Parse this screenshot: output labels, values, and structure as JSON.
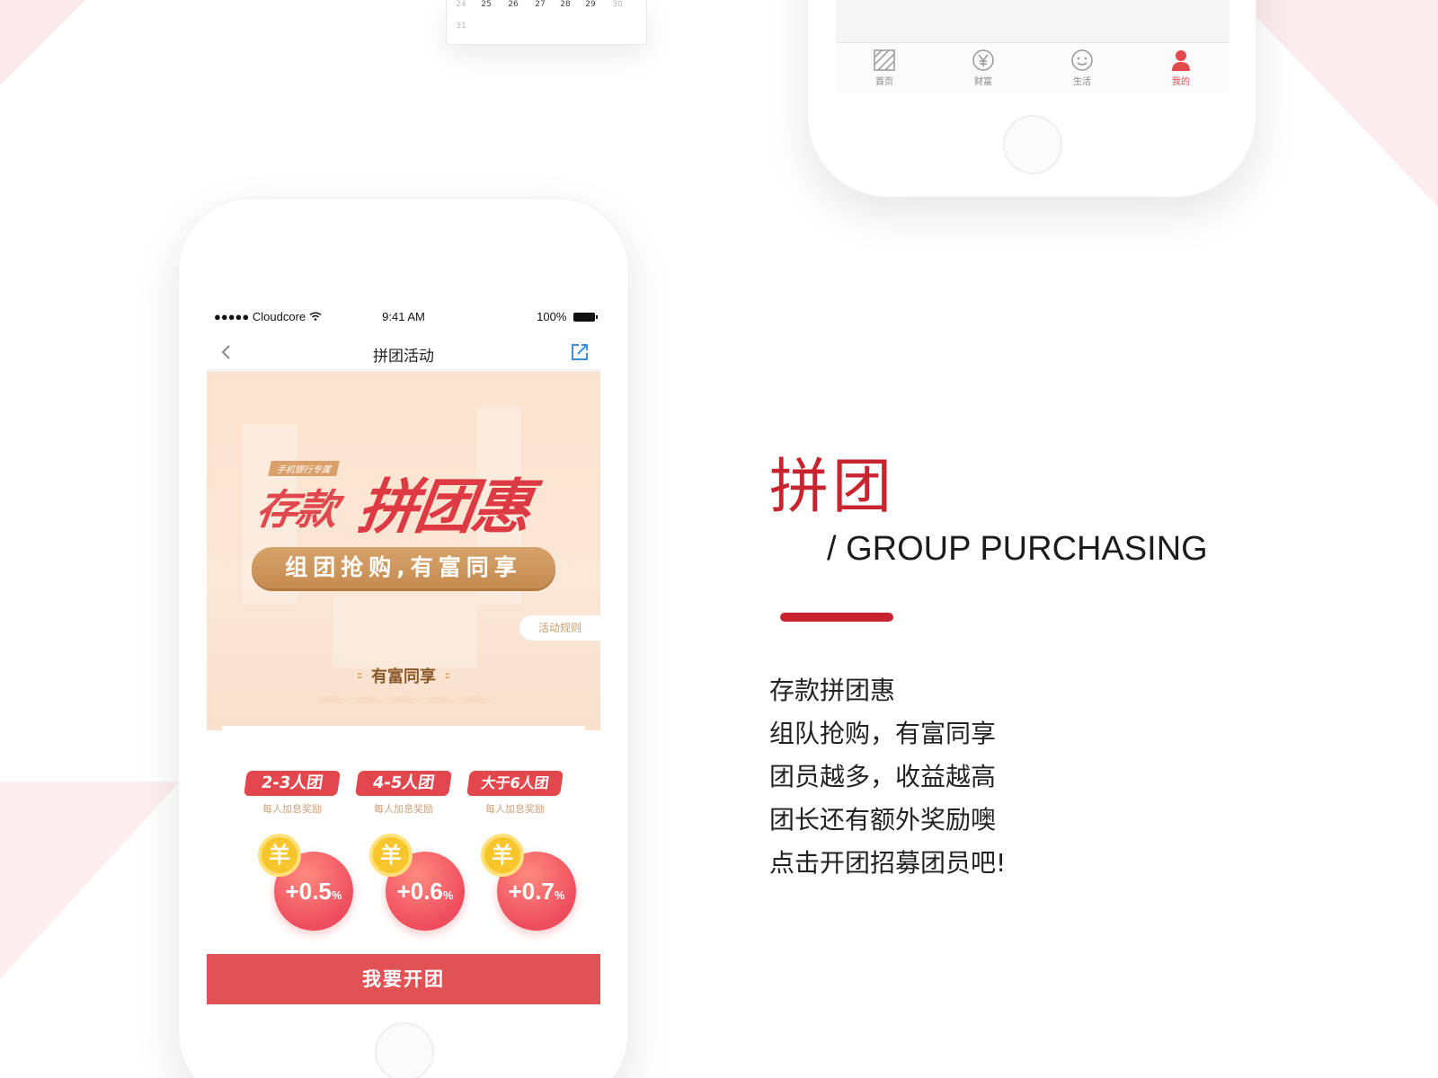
{
  "calendar": {
    "row1": [
      "24",
      "25",
      "26",
      "27",
      "28",
      "29",
      "30"
    ],
    "row2": [
      "31"
    ]
  },
  "top_phone": {
    "tabs": [
      {
        "label": "首页",
        "icon": "home-icon",
        "active": false
      },
      {
        "label": "财富",
        "icon": "yuan-icon",
        "active": false
      },
      {
        "label": "生活",
        "icon": "smile-icon",
        "active": false
      },
      {
        "label": "我的",
        "icon": "person-icon",
        "active": true
      }
    ]
  },
  "main_phone": {
    "status": {
      "carrier": "●●●●● Cloudcore",
      "time": "9:41 AM",
      "battery": "100%"
    },
    "nav": {
      "title": "拼团活动"
    },
    "banner": {
      "tag": "手机银行专属",
      "hero_part1": "存款",
      "hero_part2": "拼团惠",
      "pill": "组团抢购,有富同享",
      "rules_link": "活动规则",
      "section_title": "有富同享"
    },
    "tiers": [
      {
        "label": "2-3人团",
        "sub": "每人加息奖励",
        "rate": "+0.5",
        "unit": "%"
      },
      {
        "label": "4-5人团",
        "sub": "每人加息奖励",
        "rate": "+0.6",
        "unit": "%"
      },
      {
        "label": "大于6人团",
        "sub": "每人加息奖励",
        "rate": "+0.7",
        "unit": "%"
      }
    ],
    "coin_symbol": "羊",
    "cta": "我要开团"
  },
  "description": {
    "heading_cn": "拼团",
    "heading_en": "/ GROUP PURCHASING",
    "lines": [
      "存款拼团惠",
      "组队抢购，有富同享",
      "团员越多，收益越高",
      "团长还有额外奖励噢",
      "点击开团招募团员吧!"
    ]
  },
  "colors": {
    "brand_red": "#c8242f",
    "cta_red": "#e05254",
    "gold": "#c58b50",
    "active_tab": "#e04a4a"
  }
}
